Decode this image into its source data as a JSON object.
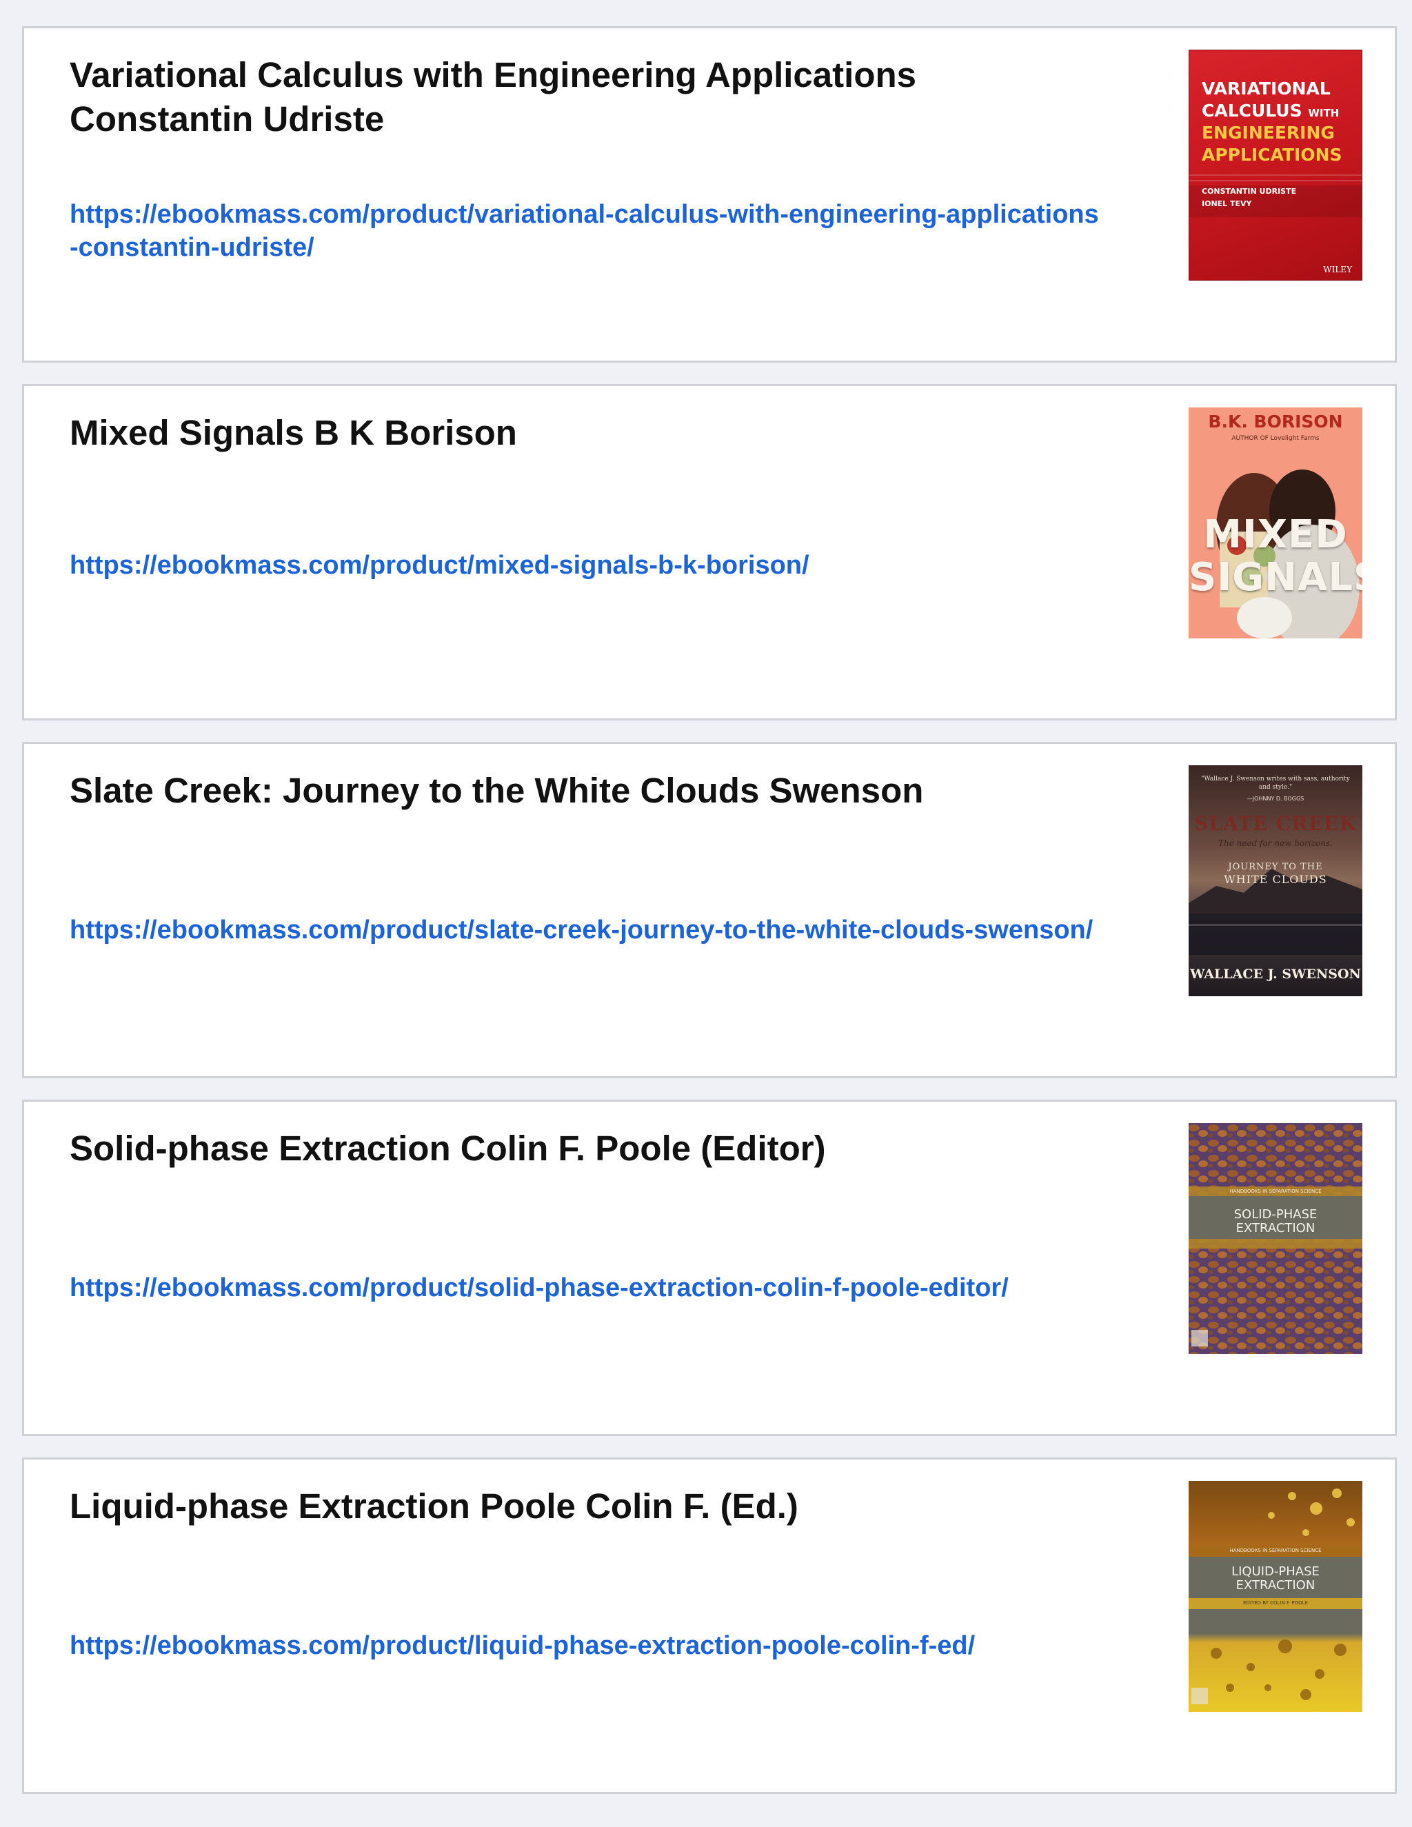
{
  "books": [
    {
      "title": "Variational Calculus with Engineering Applications Constantin Udriste",
      "link": "https://ebookmass.com/product/variational-calculus-with-engineering-applications-constantin-udriste/",
      "cover": {
        "line1": "VARIATIONAL",
        "line2a": "CALCULUS",
        "line2b": "WITH",
        "line3": "ENGINEERING",
        "line4": "APPLICATIONS",
        "author1": "CONSTANTIN UDRISTE",
        "author2": "IONEL TEVY",
        "publisher": "WILEY"
      }
    },
    {
      "title": "Mixed Signals B K Borison",
      "link": "https://ebookmass.com/product/mixed-signals-b-k-borison/",
      "cover": {
        "author": "B.K. BORISON",
        "subline": "AUTHOR OF Lovelight Farms",
        "title1": "MIXED",
        "title2": "SIGNALS"
      }
    },
    {
      "title": "Slate Creek: Journey to the White Clouds Swenson",
      "link": "https://ebookmass.com/product/slate-creek-journey-to-the-white-clouds-swenson/",
      "cover": {
        "quote": "\"Wallace J. Swenson writes with sass, authority and style.\"",
        "quote_by": "—JOHNNY D. BOGGS",
        "title": "SLATE CREEK",
        "tagline": "The need for new horizons.",
        "subtitle1": "JOURNEY TO THE",
        "subtitle2": "WHITE CLOUDS",
        "author": "WALLACE J. SWENSON"
      }
    },
    {
      "title": "Solid-phase Extraction Colin F. Poole (Editor)",
      "link": "https://ebookmass.com/product/solid-phase-extraction-colin-f-poole-editor/",
      "cover": {
        "series": "HANDBOOKS IN SEPARATION SCIENCE",
        "title1": "SOLID-PHASE",
        "title2": "EXTRACTION"
      }
    },
    {
      "title": "Liquid-phase Extraction Poole Colin F. (Ed.)",
      "link": "https://ebookmass.com/product/liquid-phase-extraction-poole-colin-f-ed/",
      "cover": {
        "series": "HANDBOOKS IN SEPARATION SCIENCE",
        "title1": "LIQUID-PHASE",
        "title2": "EXTRACTION",
        "editor": "EDITED BY COLIN F. POOLE"
      }
    }
  ]
}
